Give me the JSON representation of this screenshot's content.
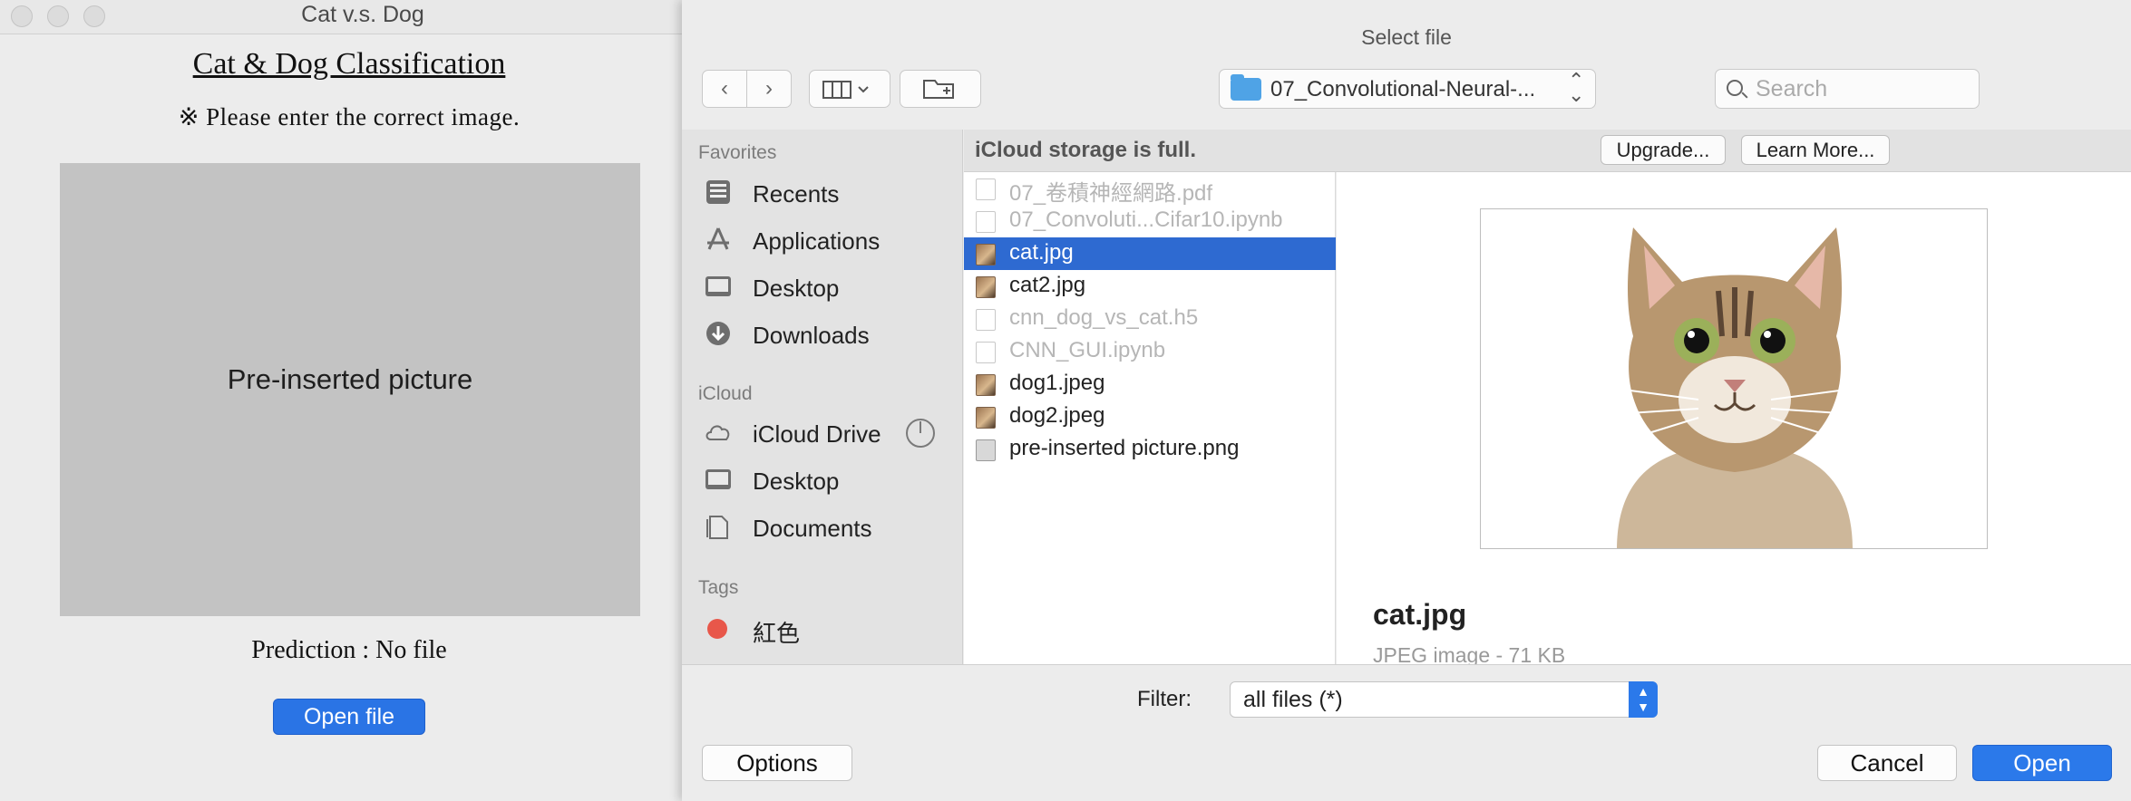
{
  "app": {
    "window_title": "Cat v.s. Dog",
    "heading": "Cat & Dog Classification",
    "notice": "※ Please enter the correct image.",
    "placeholder_text": "Pre-inserted picture",
    "prediction": "Prediction : No file",
    "open_file_label": "Open file"
  },
  "dialog": {
    "title": "Select file",
    "toolbar": {
      "back_icon": "chevron-left-icon",
      "forward_icon": "chevron-right-icon",
      "view_icon": "column-view-icon",
      "new_folder_icon": "new-folder-icon",
      "location": "07_Convolutional-Neural-...",
      "search_placeholder": "Search"
    },
    "sidebar": {
      "favorites_header": "Favorites",
      "favorites": [
        {
          "label": "Recents",
          "icon": "recents-icon"
        },
        {
          "label": "Applications",
          "icon": "applications-icon"
        },
        {
          "label": "Desktop",
          "icon": "desktop-icon"
        },
        {
          "label": "Downloads",
          "icon": "downloads-icon"
        }
      ],
      "icloud_header": "iCloud",
      "icloud": [
        {
          "label": "iCloud Drive",
          "icon": "icloud-icon"
        },
        {
          "label": "Desktop",
          "icon": "desktop-icon"
        },
        {
          "label": "Documents",
          "icon": "documents-icon"
        }
      ],
      "tags_header": "Tags",
      "tags": [
        {
          "label": "紅色",
          "color": "#e8574a"
        }
      ]
    },
    "banner": {
      "text": "iCloud storage is full.",
      "upgrade_label": "Upgrade...",
      "learn_more_label": "Learn More..."
    },
    "files": [
      {
        "name": "07_卷積神經網路.pdf",
        "enabled": false,
        "selected": false
      },
      {
        "name": "07_Convoluti...Cifar10.ipynb",
        "enabled": false,
        "selected": false
      },
      {
        "name": "cat.jpg",
        "enabled": true,
        "selected": true
      },
      {
        "name": "cat2.jpg",
        "enabled": true,
        "selected": false
      },
      {
        "name": "cnn_dog_vs_cat.h5",
        "enabled": false,
        "selected": false
      },
      {
        "name": "CNN_GUI.ipynb",
        "enabled": false,
        "selected": false
      },
      {
        "name": "dog1.jpeg",
        "enabled": true,
        "selected": false
      },
      {
        "name": "dog2.jpeg",
        "enabled": true,
        "selected": false
      },
      {
        "name": "pre-inserted picture.png",
        "enabled": true,
        "selected": false
      }
    ],
    "preview": {
      "name": "cat.jpg",
      "meta": "JPEG image - 71 KB"
    },
    "filter_label": "Filter:",
    "filter_value": "all files (*)",
    "options_label": "Options",
    "cancel_label": "Cancel",
    "open_label": "Open",
    "accent_color": "#2b79ea",
    "selection_color": "#2e6ad1"
  }
}
